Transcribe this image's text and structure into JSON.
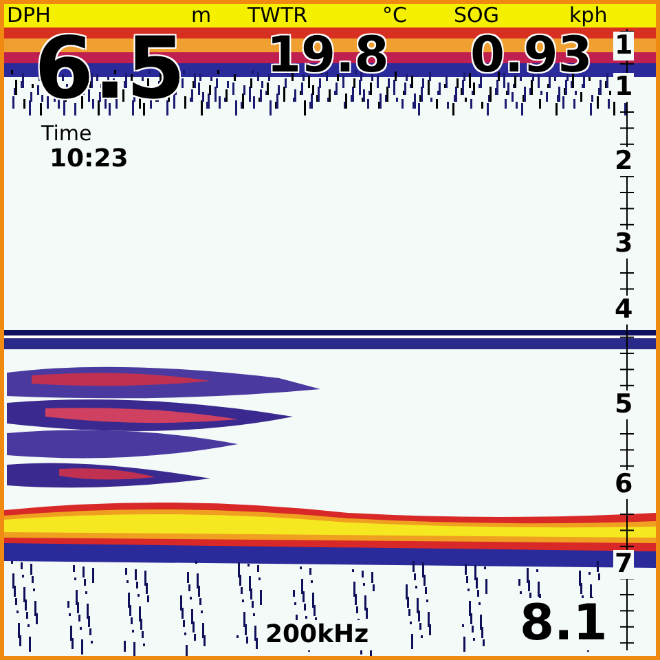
{
  "readouts": [
    {
      "label": "DPH",
      "unit": "m",
      "value": "6.5"
    },
    {
      "label": "TWTR",
      "unit": "°C",
      "value": "19.8"
    },
    {
      "label": "SOG",
      "unit": "kph",
      "value": "0.93"
    }
  ],
  "time": {
    "label": "Time",
    "value": "10:23"
  },
  "depth_scale": {
    "labels": [
      "1",
      "1",
      "2",
      "3",
      "4",
      "5",
      "6",
      "7"
    ]
  },
  "frequency": "200kHz",
  "cursor_depth": "8.1"
}
